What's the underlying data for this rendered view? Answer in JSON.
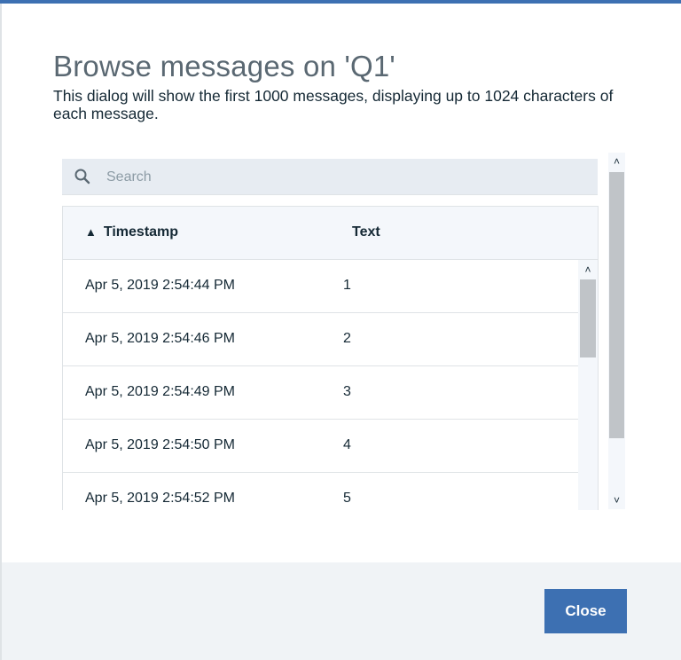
{
  "dialog": {
    "title": "Browse messages on 'Q1'",
    "description": "This dialog will show the first 1000 messages, displaying up to 1024 characters of each message."
  },
  "search": {
    "placeholder": "Search",
    "value": "",
    "icon": "search-icon"
  },
  "table": {
    "columns": [
      {
        "label": "Timestamp",
        "sort": "ascending",
        "sort_icon": "sort-ascending-icon",
        "sort_glyph": "▲"
      },
      {
        "label": "Text"
      }
    ],
    "rows": [
      {
        "timestamp": "Apr 5, 2019 2:54:44 PM",
        "text": "1"
      },
      {
        "timestamp": "Apr 5, 2019 2:54:46 PM",
        "text": "2"
      },
      {
        "timestamp": "Apr 5, 2019 2:54:49 PM",
        "text": "3"
      },
      {
        "timestamp": "Apr 5, 2019 2:54:50 PM",
        "text": "4"
      },
      {
        "timestamp": "Apr 5, 2019 2:54:52 PM",
        "text": "5"
      }
    ]
  },
  "scroll": {
    "up_glyph": "˄",
    "down_glyph": "˅"
  },
  "footer": {
    "close_label": "Close"
  },
  "colors": {
    "accent": "#3d70b2",
    "footer_bg": "#f0f3f6",
    "header_bg": "#f4f7fb",
    "search_bg": "#e7ecf2"
  }
}
